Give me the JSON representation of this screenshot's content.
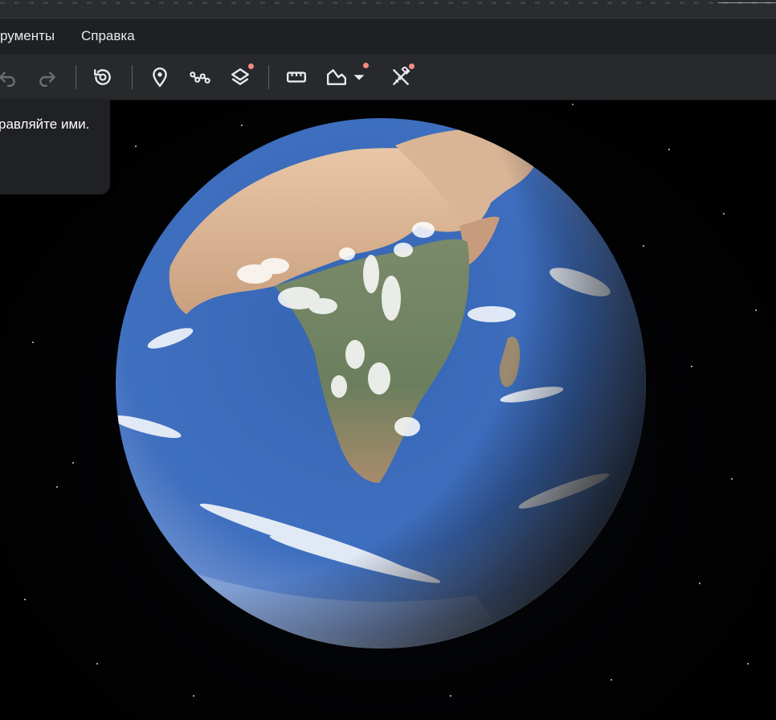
{
  "menu": {
    "items": [
      "рументы",
      "Справка"
    ]
  },
  "toolbar": {
    "buttons": [
      "undo-icon",
      "redo-icon",
      "history-icon",
      "placemark-icon",
      "path-icon",
      "layers-icon",
      "ruler-icon",
      "map-style-icon",
      "measure-tools-icon"
    ],
    "accent_dot_color": "#f28b82"
  },
  "tooltip": {
    "text": "равляйте ими."
  },
  "colors": {
    "background": "#000000",
    "menubar": "#1f2023",
    "toolbar": "#28292c",
    "ocean": "#3f6fbf"
  }
}
